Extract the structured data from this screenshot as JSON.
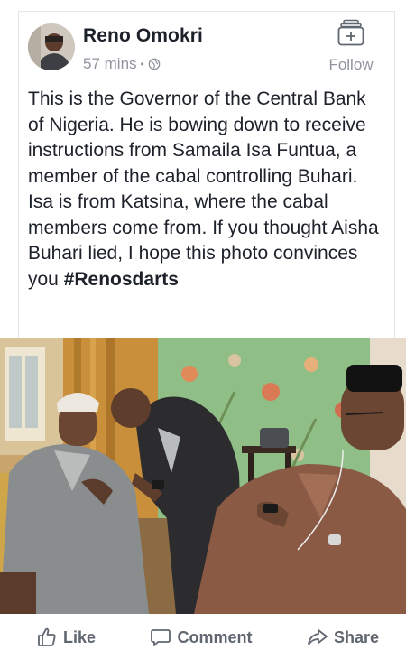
{
  "post": {
    "author": "Reno Omokri",
    "time": "57 mins",
    "separator": "•",
    "privacy_icon": "globe-icon",
    "follow_label": "Follow",
    "follow_icon": "follow-plus-icon",
    "text_main": "This is the Governor of the Central Bank of Nigeria. He is bowing down to receive instructions from Samaila Isa Funtua, a member of the cabal controlling Buhari. Isa is from Katsina, where the cabal members come from. If you thought Aisha Buhari lied, I hope this photo convinces you ",
    "hashtag": "#Renosdarts"
  },
  "actions": {
    "like": "Like",
    "comment": "Comment",
    "share": "Share"
  },
  "colors": {
    "text": "#1d2129",
    "meta": "#90949c",
    "action": "#606770",
    "wall_green": "#8fbf86",
    "robe_grey": "#8a8d8e",
    "robe_brown": "#8a5a44",
    "suit_dark": "#2c2b2e"
  }
}
